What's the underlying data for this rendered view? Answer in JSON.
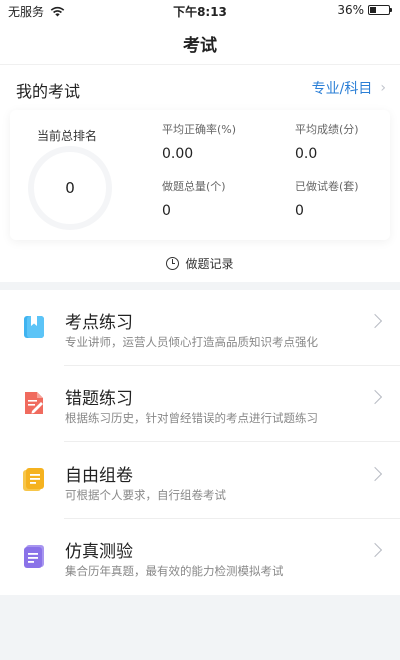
{
  "status_bar": {
    "carrier": "无服务",
    "time": "下午8:13",
    "battery": "36%",
    "battery_level": 0.36
  },
  "nav": {
    "title": "考试"
  },
  "my_exam": {
    "title": "我的考试",
    "link": "专业/科目"
  },
  "stats": {
    "rank_label": "当前总排名",
    "rank_value": "0",
    "accuracy_label": "平均正确率(%)",
    "accuracy_value": "0.00",
    "avg_score_label": "平均成绩(分)",
    "avg_score_value": "0.0",
    "total_questions_label": "做题总量(个)",
    "total_questions_value": "0",
    "papers_done_label": "已做试卷(套)",
    "papers_done_value": "0"
  },
  "record": {
    "label": "做题记录"
  },
  "practice_items": [
    {
      "name": "考点练习",
      "desc": "专业讲师，运营人员倾心打造高品质知识考点强化",
      "icon": "bookmark-book-icon",
      "color": "#3fb3f0"
    },
    {
      "name": "错题练习",
      "desc": "根据练习历史，针对曾经错误的考点进行试题练习",
      "icon": "document-edit-icon",
      "color": "#f06b5e"
    },
    {
      "name": "自由组卷",
      "desc": "可根据个人要求，自行组卷考试",
      "icon": "notepad-icon",
      "color": "#f7b62c"
    },
    {
      "name": "仿真测验",
      "desc": "集合历年真题，最有效的能力检测模拟考试",
      "icon": "test-paper-icon",
      "color": "#8a72e8"
    }
  ]
}
